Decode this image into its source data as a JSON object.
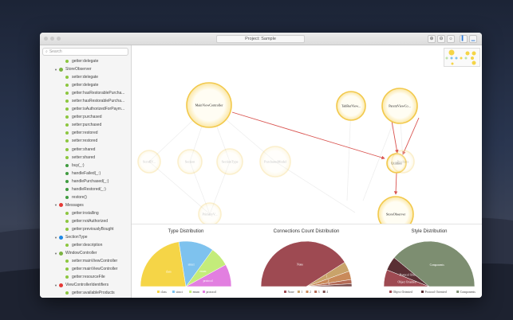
{
  "window": {
    "title": "Project: Sample",
    "search_placeholder": "Search"
  },
  "colors": {
    "node_fill": "#fffbe9",
    "node_ring": "#f2c94c",
    "edge": "#d9534f",
    "class": "#f5d547",
    "struct": "#7ec2ee",
    "enum": "#c4ec7a",
    "protocol": "#e27fe0",
    "none": "#9e4a52",
    "components": "#7d8e71",
    "object_oriented": "#9e4a52",
    "protocol_oriented": "#5a2f34"
  },
  "sidebar": {
    "items": [
      {
        "label": "getter:delegate",
        "kind": "child",
        "color": "#8cc63f"
      },
      {
        "label": "StoreObserver",
        "kind": "group",
        "color": "#7cb342"
      },
      {
        "label": "setter:delegate",
        "kind": "child",
        "color": "#8cc63f"
      },
      {
        "label": "getter:delegate",
        "kind": "child",
        "color": "#8cc63f"
      },
      {
        "label": "getter:hasRestorablePurcha...",
        "kind": "child",
        "color": "#8cc63f"
      },
      {
        "label": "setter:hasRestorablePurcha...",
        "kind": "child",
        "color": "#8cc63f"
      },
      {
        "label": "getter:isAuthorizedForPaym...",
        "kind": "child",
        "color": "#8cc63f"
      },
      {
        "label": "getter:purchased",
        "kind": "child",
        "color": "#8cc63f"
      },
      {
        "label": "setter:purchased",
        "kind": "child",
        "color": "#8cc63f"
      },
      {
        "label": "getter:restored",
        "kind": "child",
        "color": "#8cc63f"
      },
      {
        "label": "setter:restored",
        "kind": "child",
        "color": "#8cc63f"
      },
      {
        "label": "getter:shared",
        "kind": "child",
        "color": "#8cc63f"
      },
      {
        "label": "setter:shared",
        "kind": "child",
        "color": "#8cc63f"
      },
      {
        "label": "buy(_:)",
        "kind": "child",
        "color": "#3f9b3f"
      },
      {
        "label": "handleFailed(_:)",
        "kind": "child",
        "color": "#3f9b3f"
      },
      {
        "label": "handlePurchased(_:)",
        "kind": "child",
        "color": "#3f9b3f"
      },
      {
        "label": "handleRestored(_:)",
        "kind": "child",
        "color": "#3f9b3f"
      },
      {
        "label": "restore()",
        "kind": "child",
        "color": "#3f9b3f"
      },
      {
        "label": "Messages",
        "kind": "group",
        "color": "#e53935"
      },
      {
        "label": "getter:installing",
        "kind": "child",
        "color": "#8cc63f"
      },
      {
        "label": "getter:notAuthorized",
        "kind": "child",
        "color": "#8cc63f"
      },
      {
        "label": "getter:previouslyBought",
        "kind": "child",
        "color": "#8cc63f"
      },
      {
        "label": "SectionType",
        "kind": "group",
        "color": "#1e88e5"
      },
      {
        "label": "getter:description",
        "kind": "child",
        "color": "#8cc63f"
      },
      {
        "label": "WindowController",
        "kind": "group",
        "color": "#7cb342"
      },
      {
        "label": "setter:mainViewController",
        "kind": "child",
        "color": "#8cc63f"
      },
      {
        "label": "getter:mainViewController",
        "kind": "child",
        "color": "#8cc63f"
      },
      {
        "label": "getter:resourceFile",
        "kind": "child",
        "color": "#8cc63f"
      },
      {
        "label": "ViewControllerIdentifiers",
        "kind": "group",
        "color": "#e53935"
      },
      {
        "label": "getter:availableProducts",
        "kind": "child",
        "color": "#8cc63f"
      }
    ]
  },
  "graph": {
    "nodes": [
      {
        "id": "main",
        "label": "MainViewController",
        "r": 0,
        "faded": false
      },
      {
        "id": "tabbar",
        "label": "TabBarView...",
        "faded": false
      },
      {
        "id": "parent",
        "label": "ParentViewCo...",
        "faded": false
      },
      {
        "id": "utilities",
        "label": "Utilities",
        "faded": false
      },
      {
        "id": "store",
        "label": "StoreObserver",
        "faded": false
      },
      {
        "id": "scrollv",
        "label": "ScrollV...",
        "faded": true
      },
      {
        "id": "section",
        "label": "Section",
        "faded": true
      },
      {
        "id": "sectiontype",
        "label": "SectionType",
        "faded": true
      },
      {
        "id": "purchases",
        "label": "PurchasesModel",
        "faded": true
      },
      {
        "id": "products",
        "label": "Products",
        "faded": true
      },
      {
        "id": "primary",
        "label": "PrimaryV...",
        "faded": true
      }
    ]
  },
  "charts": {
    "type": {
      "title": "Type Distribution",
      "legend": [
        "class",
        "struct",
        "enum",
        "protocol"
      ],
      "labels": [
        "class",
        "struct",
        "enum",
        "protocol"
      ]
    },
    "connections": {
      "title": "Connections Count Distribution",
      "legend": [
        "None",
        "1",
        "2",
        "3",
        "4"
      ],
      "labels": [
        "None",
        "1",
        "2",
        "3"
      ]
    },
    "style": {
      "title": "Style Distribution",
      "legend": [
        "Object Oriented",
        "Protocol Oriented",
        "Components"
      ],
      "labels": [
        "Components",
        "Protocol Oriented",
        "Object Oriented"
      ]
    }
  },
  "chart_data": [
    {
      "type": "pie",
      "title": "Type Distribution",
      "categories": [
        "class",
        "struct",
        "enum",
        "protocol"
      ],
      "values": [
        45,
        25,
        14,
        16
      ]
    },
    {
      "type": "pie",
      "title": "Connections Count Distribution",
      "categories": [
        "None",
        "1",
        "2",
        "3",
        "4"
      ],
      "values": [
        82,
        7,
        6,
        3,
        2
      ]
    },
    {
      "type": "pie",
      "title": "Style Distribution",
      "categories": [
        "Object Oriented",
        "Protocol Oriented",
        "Components"
      ],
      "values": [
        12,
        10,
        78
      ]
    }
  ]
}
